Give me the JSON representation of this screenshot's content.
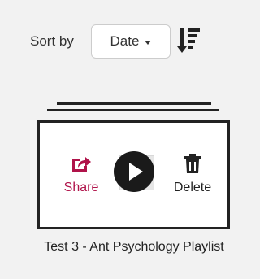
{
  "sort": {
    "label": "Sort by",
    "selected": "Date",
    "order_icon": "sort-amount-down-icon"
  },
  "playlist": {
    "share_label": "Share",
    "delete_label": "Delete",
    "title": "Test 3 - Ant Psychology Playlist",
    "icons": {
      "share": "share-icon",
      "delete": "trash-icon",
      "play": "play-circle-icon"
    }
  },
  "colors": {
    "share": "#b0134a",
    "text": "#333333",
    "background": "#f2f2f2"
  }
}
